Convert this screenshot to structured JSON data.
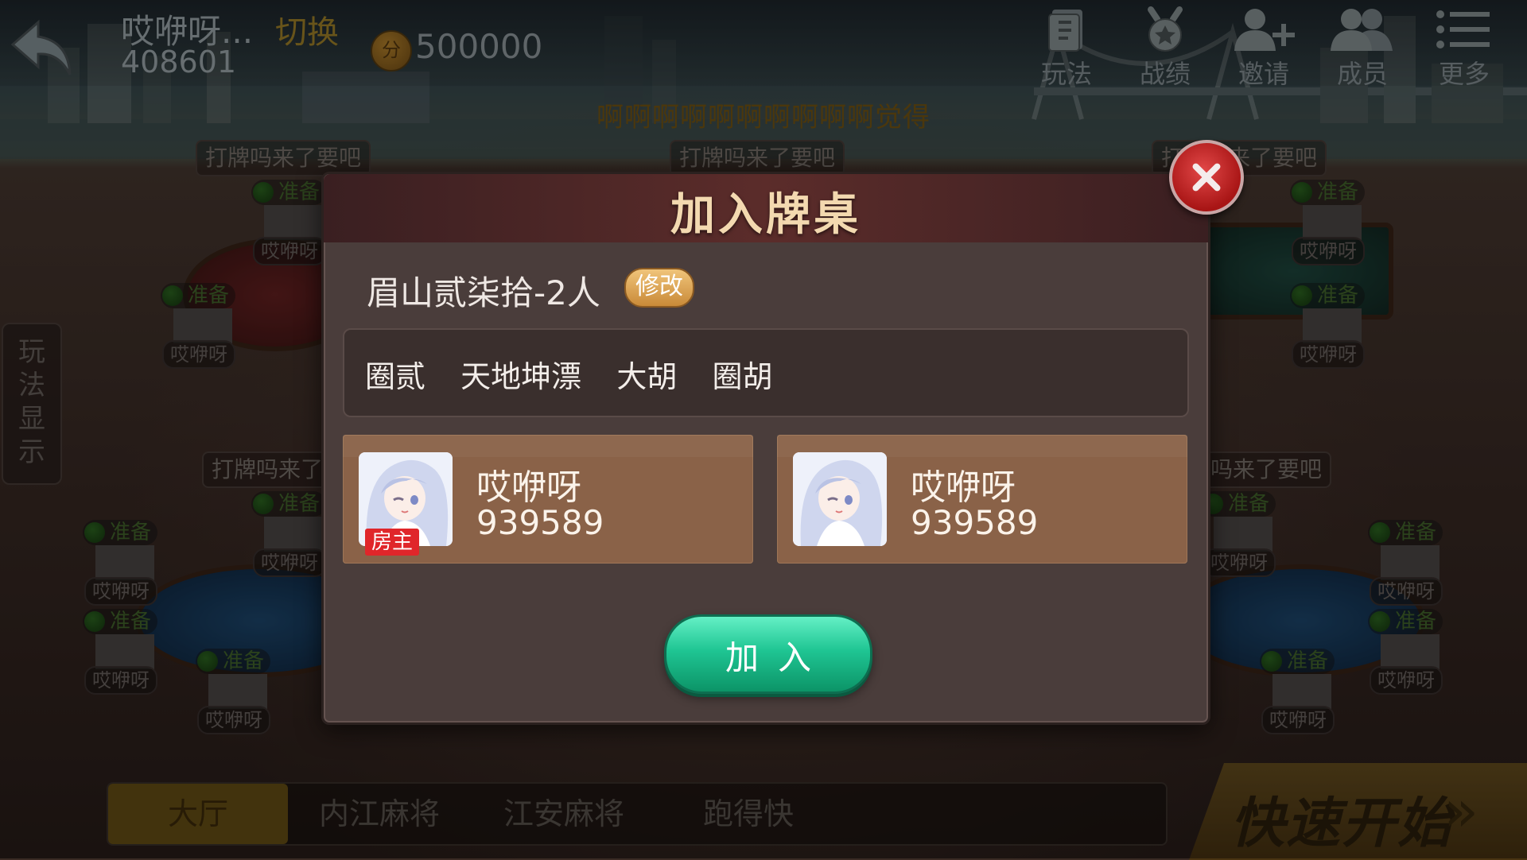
{
  "header": {
    "club_name": "哎咿呀...",
    "club_id": "408601",
    "switch_label": "切换",
    "coin_icon_text": "分",
    "coins": "500000",
    "nav": [
      {
        "label": "玩法",
        "icon": "rules-icon"
      },
      {
        "label": "战绩",
        "icon": "record-icon"
      },
      {
        "label": "邀请",
        "icon": "invite-icon"
      },
      {
        "label": "成员",
        "icon": "members-icon"
      },
      {
        "label": "更多",
        "icon": "menu-icon"
      }
    ],
    "marquee": "啊啊啊啊啊啊啊啊啊啊觉得"
  },
  "lobby": {
    "table_labels": [
      "打牌吗来了要吧",
      "打牌吗来了要吧",
      "打牌吗来了要吧",
      "打牌吗来了",
      "吗来了要吧"
    ],
    "ready_label": "准备",
    "seat_name": "哎咿呀"
  },
  "side_tab": {
    "label": "玩法显示"
  },
  "bottom_tabs": [
    "大厅",
    "内江麻将",
    "江安麻将",
    "跑得快"
  ],
  "quick_start": "快速开始",
  "quick_start_arrows": "»",
  "dialog": {
    "title": "加入牌桌",
    "room_name": "眉山贰柒拾-2人",
    "edit_label": "修改",
    "rules": "圈贰  天地坤漂  大胡  圈胡",
    "players": [
      {
        "name": "哎咿呀",
        "id": "939589",
        "badge": "房主"
      },
      {
        "name": "哎咿呀",
        "id": "939589",
        "badge": ""
      }
    ],
    "join_label": "加入"
  },
  "colors": {
    "join_green": "#1fc593",
    "close_red": "#c41f1f",
    "title_gold": "#f3d9b0",
    "player_card": "#8a6248",
    "host_badge": "#e0262a"
  }
}
